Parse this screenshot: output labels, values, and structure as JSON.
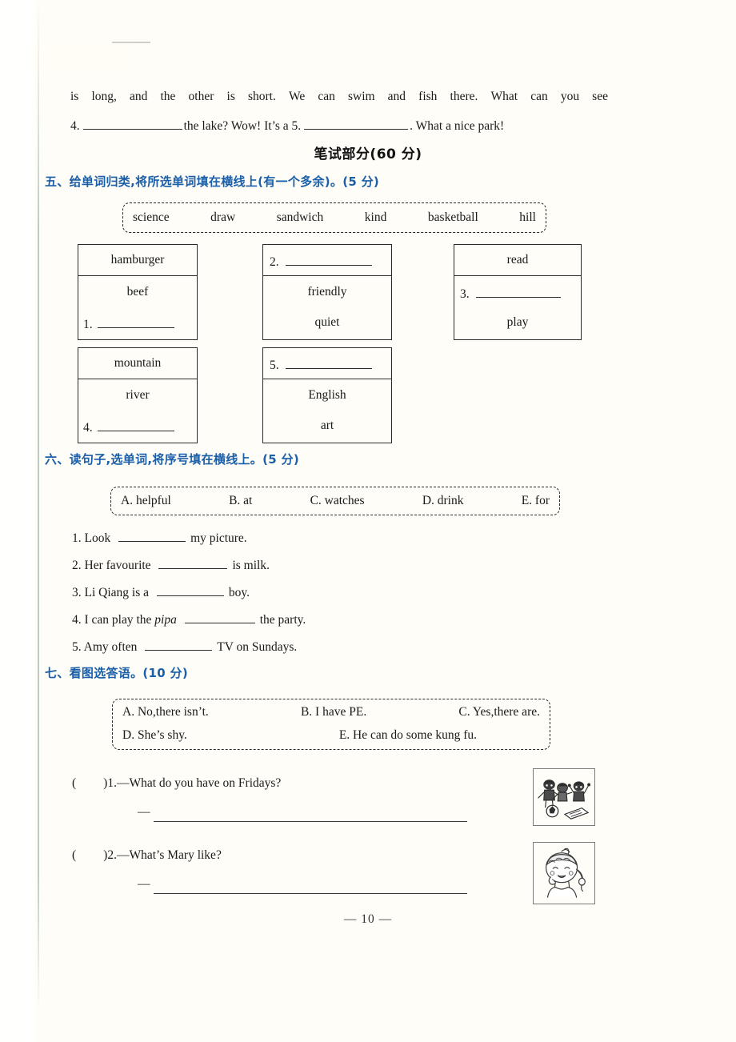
{
  "page": {
    "number_label": "— 10 —",
    "accent_blue": "#1b5fa8",
    "ink": "#1a1a1a"
  },
  "reading_tail": {
    "line1_words": [
      "is",
      "long,",
      "and",
      "the",
      "other",
      "is",
      "short.",
      "We",
      "can",
      "swim",
      "and",
      "fish",
      "there.",
      "What",
      "can",
      "you",
      "see"
    ],
    "line2_prefix": "4.",
    "line2_mid": "the lake?  Wow!  It’s a 5.",
    "line2_suffix": ". What a nice park!"
  },
  "part_title": "笔试部分(60 分)",
  "section5": {
    "heading": "五、给单词归类,将所选单词填在横线上(有一个多余)。(5 分)",
    "wordbank": [
      "science",
      "draw",
      "sandwich",
      "kind",
      "basketball",
      "hill"
    ],
    "boxes": [
      {
        "id": "box-food",
        "header": "hamburger",
        "rows": [
          "beef"
        ],
        "blank_number": "1.",
        "blank_position": "bottom"
      },
      {
        "id": "box-personality",
        "header": "",
        "header_blank_number": "2.",
        "rows": [
          "friendly",
          "quiet"
        ],
        "blank_position": "header"
      },
      {
        "id": "box-activities",
        "header": "read",
        "rows": [
          "play"
        ],
        "blank_number": "3.",
        "blank_position": "middle"
      },
      {
        "id": "box-nature",
        "header": "mountain",
        "rows": [
          "river"
        ],
        "blank_number": "4.",
        "blank_position": "bottom"
      },
      {
        "id": "box-subjects",
        "header": "",
        "header_blank_number": "5.",
        "rows": [
          "English",
          "art"
        ],
        "blank_position": "header"
      }
    ]
  },
  "section6": {
    "heading": "六、读句子,选单词,将序号填在横线上。(5 分)",
    "wordbank": [
      "A. helpful",
      "B. at",
      "C. watches",
      "D. drink",
      "E. for"
    ],
    "questions": [
      {
        "number": "1.",
        "before": "Look",
        "italic": "",
        "after": "my picture."
      },
      {
        "number": "2.",
        "before": "Her favourite",
        "italic": "",
        "after": "is milk."
      },
      {
        "number": "3.",
        "before": "Li Qiang is a",
        "italic": "",
        "after": "boy."
      },
      {
        "number": "4.",
        "before": "I can play the",
        "italic": "pipa",
        "after": "the party."
      },
      {
        "number": "5.",
        "before": "Amy often",
        "italic": "",
        "after": "TV on Sundays."
      }
    ]
  },
  "section7": {
    "heading": "七、看图选答语。(10 分)",
    "wordbank_row1": [
      "A. No,there isn’t.",
      "B. I have PE.",
      "C. Yes,there are."
    ],
    "wordbank_row2": [
      "D. She’s shy.",
      "E. He can do some kung fu."
    ],
    "items": [
      {
        "paren": "(",
        "paren_close": ")",
        "number": "1.",
        "dash": "—",
        "question": "What do you have on Fridays?",
        "answer_dash": "—",
        "picture": "children-playing-football-picture"
      },
      {
        "paren": "(",
        "paren_close": ")",
        "number": "2.",
        "dash": "—",
        "question": "What’s Mary like?",
        "answer_dash": "—",
        "picture": "shy-girl-picture"
      }
    ]
  }
}
